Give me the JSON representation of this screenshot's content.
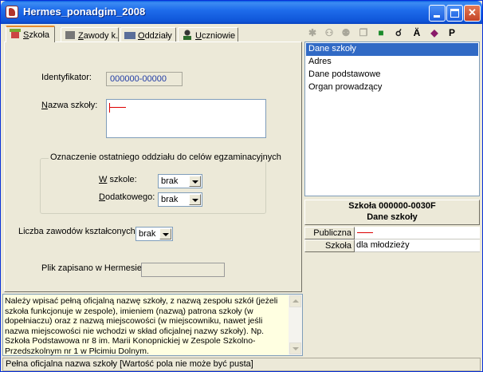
{
  "window": {
    "title": "Hermes_ponadgim_2008",
    "accent": "#0A5FE3"
  },
  "tabs": [
    {
      "label_pre": "",
      "label_u": "S",
      "label_post": "zkoła",
      "icon": "school-icon",
      "active": true
    },
    {
      "label_pre": "",
      "label_u": "Z",
      "label_post": "awody k.",
      "icon": "professions-icon",
      "active": false
    },
    {
      "label_pre": "",
      "label_u": "O",
      "label_post": "ddziały",
      "icon": "branches-icon",
      "active": false
    },
    {
      "label_pre": "",
      "label_u": "U",
      "label_post": "czniowie",
      "icon": "students-icon",
      "active": false
    }
  ],
  "toolbar": [
    {
      "icon": "person-star-icon",
      "glyph": "✱",
      "enabled": false
    },
    {
      "icon": "people-arrow-icon",
      "glyph": "⚇",
      "enabled": false
    },
    {
      "icon": "people-icon",
      "glyph": "⚉",
      "enabled": false
    },
    {
      "icon": "copy-icon",
      "glyph": "❐",
      "enabled": false
    },
    {
      "icon": "save-icon",
      "glyph": "■",
      "enabled": true
    },
    {
      "icon": "find-icon",
      "glyph": "☌",
      "enabled": true
    },
    {
      "icon": "a-umlaut-icon",
      "glyph": "Ä",
      "enabled": true
    },
    {
      "icon": "book-icon",
      "glyph": "◆",
      "enabled": true
    },
    {
      "icon": "p-letter-icon",
      "glyph": "P",
      "enabled": true
    }
  ],
  "form": {
    "identifier_label": "Identyfikator:",
    "identifier_value": "000000-00000",
    "school_name_label_u": "N",
    "school_name_label_rest": "azwa szkoły:",
    "group_title": "Oznaczenie ostatniego oddziału do celów egzaminacyjnych",
    "in_school_label_u": "W",
    "in_school_label_rest": " szkole:",
    "in_school_value": "brak",
    "additional_label_u": "D",
    "additional_label_rest": "odatkowego:",
    "additional_value": "brak",
    "professions_count_label": "Liczba zawodów kształconych:",
    "professions_count_value": "brak",
    "file_saved_label": "Plik zapisano w Hermesie:"
  },
  "list": {
    "items": [
      "Dane szkoły",
      "Adres",
      "Dane podstawowe",
      "Organ prowadzący"
    ],
    "selected": 0
  },
  "info": {
    "line1": "Szkoła 000000-0030F",
    "line2": "Dane szkoły"
  },
  "props": [
    {
      "key": "Publiczna",
      "value": ""
    },
    {
      "key": "Szkoła",
      "value": "dla młodzieży"
    }
  ],
  "help": {
    "text": "Należy wpisać pełną oficjalną nazwę szkoły, z nazwą zespołu szkół (jeżeli szkoła funkcjonuje w zespole), imieniem (nazwą) patrona szkoły (w dopełniaczu) oraz z nazwą miejscowości (w miejscowniku, nawet jeśli nazwa miejscowości nie wchodzi w skład oficjalnej nazwy szkoły). Np. Szkoła Podstawowa nr 8 im. Marii Konopnickiej w Zespole Szkolno-Przedszkolnym nr 1 w Płcimiu Dolnym."
  },
  "status": {
    "text": "Pełna oficjalna nazwa szkoły [Wartość pola nie może być pusta]"
  }
}
